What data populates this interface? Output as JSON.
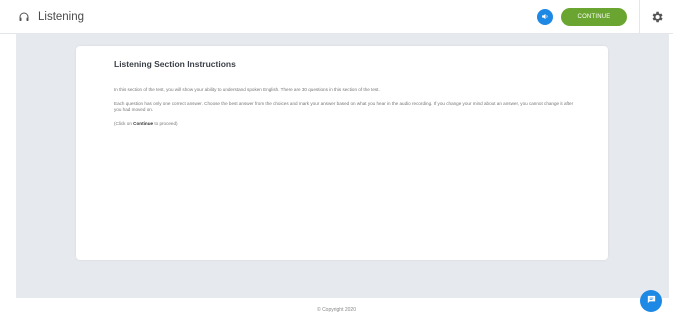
{
  "header": {
    "app_title": "Listening",
    "continue_label": "CONTINUE",
    "accent_color": "#1e88e5",
    "continue_color": "#6ba531",
    "icons": [
      "headphones-icon",
      "volume-icon",
      "gear-icon"
    ]
  },
  "instructions": {
    "title": "Listening Section Instructions",
    "paragraph_1": "In this section of the test, you will show your ability to understand spoken English. There are 30 questions in this section of the test.",
    "paragraph_2": "Each question has only one correct answer. Choose the best answer from the choices and mark your answer based on what you hear in the audio recording. If you change your mind about an answer, you cannot change it after you had moved on.",
    "click_prefix": "(Click on ",
    "click_bold": "Continue",
    "click_suffix": " to proceed)"
  },
  "footer": {
    "copyright": "© Copyright 2020"
  },
  "chat": {
    "icon": "chat-icon"
  }
}
